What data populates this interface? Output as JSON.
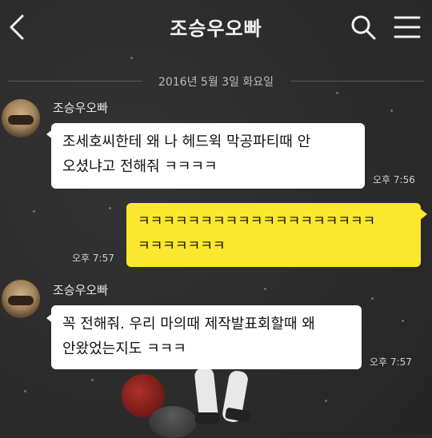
{
  "header": {
    "title": "조승우오빠",
    "back_icon": "chevron-left-icon",
    "search_icon": "search-icon",
    "menu_icon": "hamburger-menu-icon"
  },
  "date_divider": "2016년 5월 3일 화요일",
  "messages": [
    {
      "sender": "조승우오빠",
      "lines": [
        "조세호씨한테 왜 나 헤드윅 막공파티때 안",
        "오셨냐고 전해줘 ㅋㅋㅋㅋ"
      ],
      "time": "오후 7:56"
    },
    {
      "sender": "me",
      "lines": [
        "ㅋㅋㅋㅋㅋㅋㅋㅋㅋㅋㅋㅋㅋㅋㅋㅋㅋㅋㅋ",
        "ㅋㅋㅋㅋㅋㅋㅋ"
      ],
      "time": "오후 7:57"
    },
    {
      "sender": "조승우오빠",
      "lines": [
        "꼭 전해줘. 우리 마의때 제작발표회할때 왜",
        "안왔었는지도 ㅋㅋㅋ"
      ],
      "time": "오후 7:57"
    }
  ],
  "colors": {
    "background": "#2a2a2a",
    "incoming_bubble": "#ffffff",
    "outgoing_bubble": "#fbe72d"
  }
}
